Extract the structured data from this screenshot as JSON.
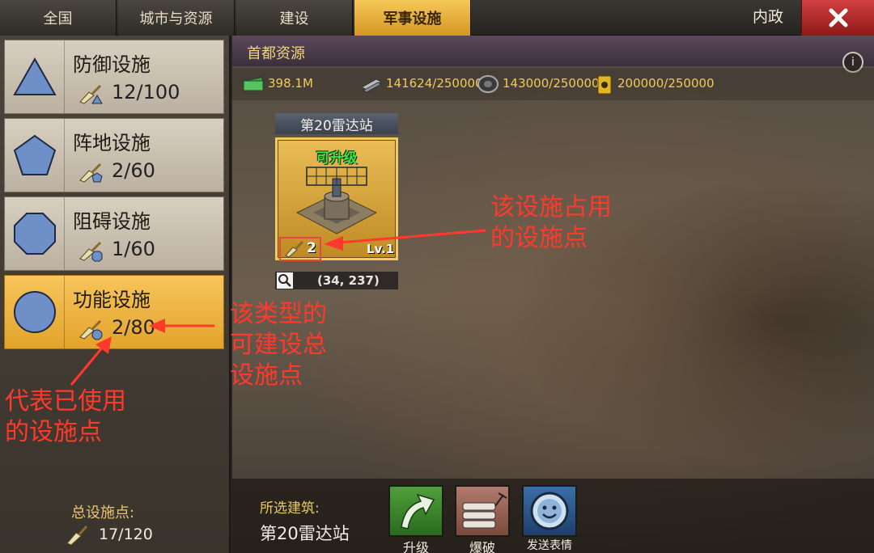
{
  "tabs": [
    "全国",
    "城市与资源",
    "建设",
    "军事设施"
  ],
  "active_tab": "军事设施",
  "interior_tab": "内政",
  "sidebar": {
    "categories": [
      {
        "name": "防御设施",
        "count": "12/100",
        "shape": "triangle"
      },
      {
        "name": "阵地设施",
        "count": "2/60",
        "shape": "pentagon"
      },
      {
        "name": "阻碍设施",
        "count": "1/60",
        "shape": "octagon"
      },
      {
        "name": "功能设施",
        "count": "2/80",
        "shape": "circle"
      }
    ],
    "total_label": "总设施点:",
    "total_count": "17/120"
  },
  "main": {
    "resources_title": "首都资源",
    "info_label": "i",
    "resources": [
      {
        "icon": "cash-icon",
        "value": "398.1M"
      },
      {
        "icon": "steel-icon",
        "value": "141624/250000"
      },
      {
        "icon": "rubber-icon",
        "value": "143000/250000"
      },
      {
        "icon": "oil-icon",
        "value": "200000/250000"
      }
    ],
    "building": {
      "title": "第20雷达站",
      "status": "可升级",
      "points": "2",
      "level": "Lv.1",
      "coords": "(34, 237)"
    }
  },
  "annotations": {
    "occupied": [
      "该设施占用",
      "的设施点"
    ],
    "total_type": [
      "该类型的",
      "可建设总",
      "设施点"
    ],
    "used": [
      "代表已使用",
      "的设施点"
    ]
  },
  "bottom": {
    "selected_label": "所选建筑:",
    "selected_value": "第20雷达站",
    "actions": [
      {
        "label": "升级",
        "icon": "upgrade-arrow-icon"
      },
      {
        "label": "爆破",
        "icon": "dynamite-icon"
      },
      {
        "label": "发送表情",
        "icon": "emoji-icon"
      }
    ]
  },
  "colors": {
    "accent": "#f0c95a",
    "annotation": "#ff3a2d",
    "active_tab": "#e3a32b",
    "close": "#c03030"
  }
}
